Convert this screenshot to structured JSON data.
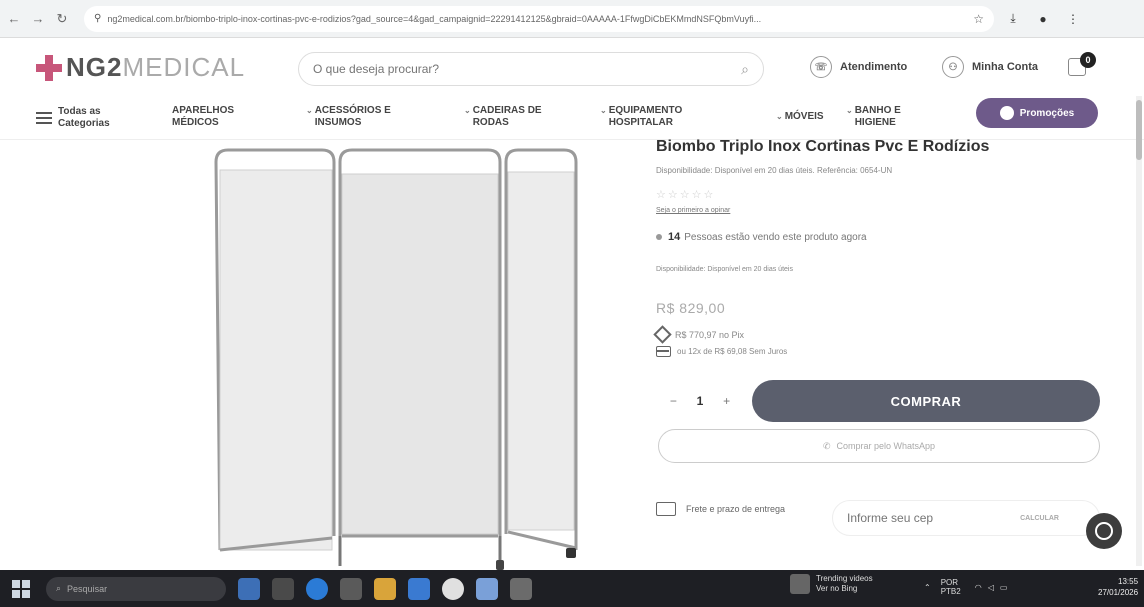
{
  "browser": {
    "url": "ng2medical.com.br/biombo-triplo-inox-cortinas-pvc-e-rodizios?gad_source=4&gad_campaignid=22291412125&gbraid=0AAAAA-1FfwgDiCbEKMmdNSFQbmVuyfi..."
  },
  "header": {
    "logo_bold": "NG2",
    "logo_light": "MEDICAL",
    "search_placeholder": "O que deseja procurar?",
    "atendimento": "Atendimento",
    "minha_conta": "Minha Conta",
    "cart_count": "0"
  },
  "nav": {
    "all_categories": "Todas as Categorias",
    "items": [
      "APARELHOS MÉDICOS",
      "ACESSÓRIOS E INSUMOS",
      "CADEIRAS DE RODAS",
      "EQUIPAMENTO HOSPITALAR",
      "MÓVEIS",
      "BANHO E HIGIENE"
    ],
    "promo": "Promoções"
  },
  "product": {
    "title": "Biombo Triplo Inox Cortinas Pvc E Rodízios",
    "availability": "Disponibilidade: Disponível em 20 dias úteis.  Referência: 0654-UN",
    "rating_stars": "☆☆☆☆☆",
    "review_link": "Seja o primeiro a opinar",
    "viewers_count": "14",
    "viewers_text": "Pessoas estão vendo este produto agora",
    "availability2": "Disponibilidade: Disponível em 20 dias úteis",
    "price": "R$ 829,00",
    "pix_price": "R$ 770,97 no Pix",
    "installments": "ou 12x de R$ 69,08 Sem Juros",
    "quantity": "1",
    "buy_label": "COMPRAR",
    "whatsapp_label": "Comprar pelo WhatsApp",
    "shipping_label": "Frete e prazo de entrega",
    "cep_placeholder": "Informe seu cep",
    "cep_button": "CALCULAR"
  },
  "taskbar": {
    "search": "Pesquisar",
    "weather_title": "Trending videos",
    "weather_sub": "Ver no Bing",
    "lang": "POR PTB2",
    "time": "13:55",
    "date": "27/01/2026"
  },
  "colors": {
    "brand_accent": "#c7567a",
    "buy_button": "#5b5f6d",
    "promo_button": "#6e5a8a"
  }
}
